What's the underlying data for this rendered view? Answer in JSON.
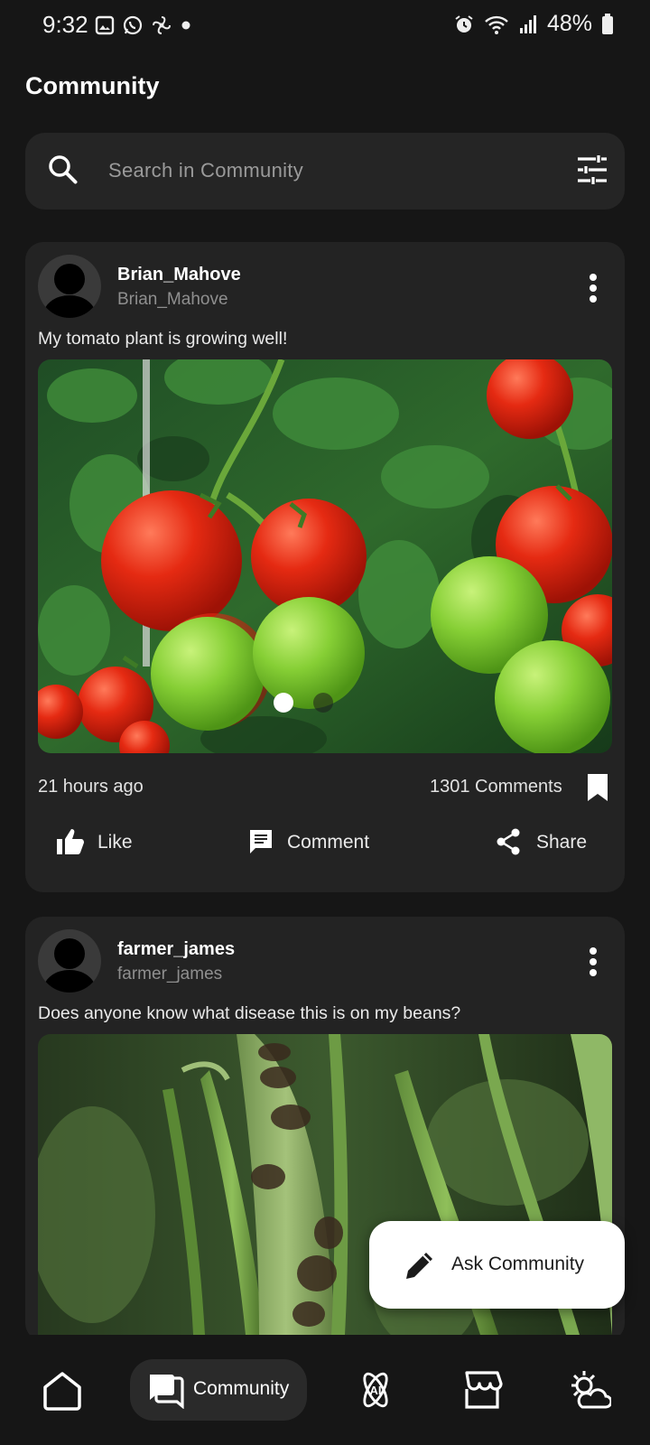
{
  "status_bar": {
    "time": "9:32",
    "battery": "48%",
    "left_icons": [
      "gallery-icon",
      "whatsapp-icon",
      "pinwheel-icon",
      "dot-icon"
    ],
    "right_icons": [
      "alarm-icon",
      "wifi-icon",
      "signal-icon",
      "battery-icon"
    ]
  },
  "header": {
    "title": "Community"
  },
  "search": {
    "placeholder": "Search in Community",
    "icons": [
      "search-icon",
      "filter-sliders-icon"
    ]
  },
  "posts": [
    {
      "username": "Brian_Mahove",
      "handle": "Brian_Mahove",
      "text": "My tomato plant is growing well!",
      "image_subject": "tomatoes",
      "carousel_pages": 2,
      "carousel_active": 1,
      "time_ago": "21 hours ago",
      "comments": "1301 Comments",
      "actions": {
        "like": "Like",
        "comment": "Comment",
        "share": "Share"
      }
    },
    {
      "username": "farmer_james",
      "handle": "farmer_james",
      "text": "Does anyone know what disease this is on my beans?",
      "image_subject": "beans"
    }
  ],
  "fab": {
    "label": "Ask Community",
    "icon": "pencil-icon"
  },
  "bottom_nav": {
    "items": [
      {
        "icon": "home-icon",
        "label": ""
      },
      {
        "icon": "community-chat-icon",
        "label": "Community",
        "active": true
      },
      {
        "icon": "ai-atom-icon",
        "label": ""
      },
      {
        "icon": "store-icon",
        "label": ""
      },
      {
        "icon": "weather-icon",
        "label": ""
      }
    ]
  },
  "colors": {
    "background": "#161616",
    "card": "#232323",
    "search": "#252525",
    "fab": "#ffffff",
    "nav_pill": "#2a2a2a"
  }
}
